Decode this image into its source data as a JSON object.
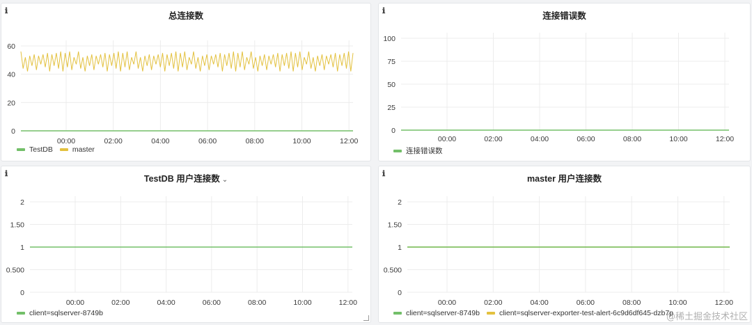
{
  "theme": {
    "green": "#73bf69",
    "yellow": "#e3c13f",
    "grid": "#ececec",
    "axis_text": "#3a3a3a"
  },
  "x_ticks": [
    "00:00",
    "02:00",
    "04:00",
    "06:00",
    "08:00",
    "10:00",
    "12:00"
  ],
  "watermark": "@稀土掘金技术社区",
  "panels": [
    {
      "title": "总连接数",
      "has_caret": false,
      "legend": [
        {
          "name": "TestDB",
          "color": "#73bf69"
        },
        {
          "name": "master",
          "color": "#e3c13f"
        }
      ]
    },
    {
      "title": "连接错误数",
      "has_caret": false,
      "legend": [
        {
          "name": "连接错误数",
          "color": "#73bf69"
        }
      ]
    },
    {
      "title": "TestDB 用户连接数",
      "has_caret": true,
      "caret": "⌄",
      "legend": [
        {
          "name": "client=sqlserver-8749b",
          "color": "#73bf69"
        }
      ]
    },
    {
      "title": "master 用户连接数",
      "has_caret": false,
      "legend": [
        {
          "name": "client=sqlserver-8749b",
          "color": "#73bf69"
        },
        {
          "name": "client=sqlserver-exporter-test-alert-6c9d6df645-dzb7p",
          "color": "#e3c13f"
        }
      ]
    }
  ],
  "chart_data": [
    {
      "type": "line",
      "title": "总连接数",
      "x": [
        "00:00",
        "02:00",
        "04:00",
        "06:00",
        "08:00",
        "10:00",
        "12:00"
      ],
      "y_ticks": [
        "0",
        "20",
        "40",
        "60"
      ],
      "ylim": [
        0,
        60
      ],
      "grid": true,
      "legend_position": "bottom-left",
      "series": [
        {
          "name": "TestDB",
          "values": [
            0,
            0,
            0,
            0,
            0,
            0,
            0
          ]
        },
        {
          "name": "master",
          "values": [
            50,
            49,
            50,
            49,
            50,
            50,
            49
          ],
          "range": [
            42,
            56
          ]
        }
      ]
    },
    {
      "type": "line",
      "title": "连接错误数",
      "x": [
        "00:00",
        "02:00",
        "04:00",
        "06:00",
        "08:00",
        "10:00",
        "12:00"
      ],
      "y_ticks": [
        "0",
        "25",
        "50",
        "75",
        "100"
      ],
      "ylim": [
        0,
        100
      ],
      "grid": true,
      "legend_position": "bottom-left",
      "series": [
        {
          "name": "连接错误数",
          "values": [
            0,
            0,
            0,
            0,
            0,
            0,
            0
          ]
        }
      ]
    },
    {
      "type": "line",
      "title": "TestDB 用户连接数",
      "x": [
        "00:00",
        "02:00",
        "04:00",
        "06:00",
        "08:00",
        "10:00",
        "12:00"
      ],
      "y_ticks": [
        "0",
        "0.500",
        "1",
        "1.50",
        "2"
      ],
      "ylim": [
        0,
        2
      ],
      "grid": true,
      "legend_position": "bottom-left",
      "series": [
        {
          "name": "client=sqlserver-8749b",
          "values": [
            1,
            1,
            1,
            1,
            1,
            1,
            1
          ]
        }
      ]
    },
    {
      "type": "line",
      "title": "master 用户连接数",
      "x": [
        "00:00",
        "02:00",
        "04:00",
        "06:00",
        "08:00",
        "10:00",
        "12:00"
      ],
      "y_ticks": [
        "0",
        "0.500",
        "1",
        "1.50",
        "2"
      ],
      "ylim": [
        0,
        2
      ],
      "grid": true,
      "legend_position": "bottom-left",
      "series": [
        {
          "name": "client=sqlserver-8749b",
          "values": [
            1,
            1,
            1,
            1,
            1,
            1,
            1
          ]
        },
        {
          "name": "client=sqlserver-exporter-test-alert-6c9d6df645-dzb7p",
          "values": [
            1,
            1,
            1,
            1,
            1,
            1,
            1
          ]
        }
      ]
    }
  ]
}
